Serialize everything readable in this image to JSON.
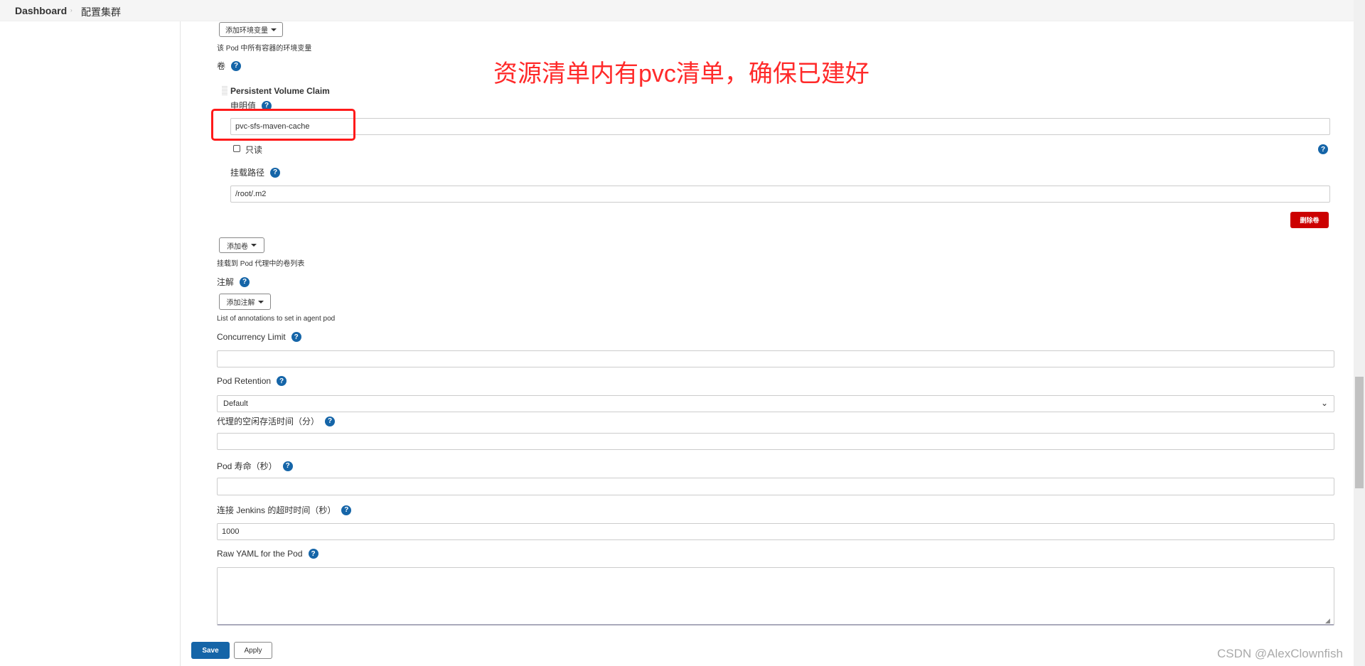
{
  "breadcrumb": {
    "items": [
      "Dashboard",
      "配置集群"
    ]
  },
  "env": {
    "add_button": "添加环境变量",
    "hint": "该 Pod 中所有容器的环境变量"
  },
  "volumes": {
    "label": "卷",
    "pvc": {
      "title": "Persistent Volume Claim",
      "claim_label": "申明值",
      "claim_value": "pvc-sfs-maven-cache",
      "readonly_label": "只读",
      "readonly_checked": false,
      "mount_label": "挂载路径",
      "mount_value": "/root/.m2",
      "delete_button": "删除卷"
    },
    "add_button": "添加卷",
    "hint": "挂载到 Pod 代理中的卷列表"
  },
  "annotations": {
    "label": "注解",
    "add_button": "添加注解",
    "hint": "List of annotations to set in agent pod"
  },
  "concurrency": {
    "label": "Concurrency Limit",
    "value": ""
  },
  "retention": {
    "label": "Pod Retention",
    "value": "Default"
  },
  "idle": {
    "label": "代理的空闲存活时间（分）",
    "value": ""
  },
  "lifetime": {
    "label": "Pod 寿命（秒）",
    "value": ""
  },
  "timeout": {
    "label": "连接 Jenkins 的超时时间（秒）",
    "value": "1000"
  },
  "yaml": {
    "label": "Raw YAML for the Pod",
    "value": ""
  },
  "actions": {
    "save": "Save",
    "apply": "Apply"
  },
  "annotation_overlay": {
    "text": "资源清单内有pvc清单，确保已建好",
    "color": "#ff2a2a"
  },
  "watermark": "CSDN @AlexClownfish",
  "colors": {
    "primary": "#1565a8",
    "danger": "#cc0000"
  }
}
